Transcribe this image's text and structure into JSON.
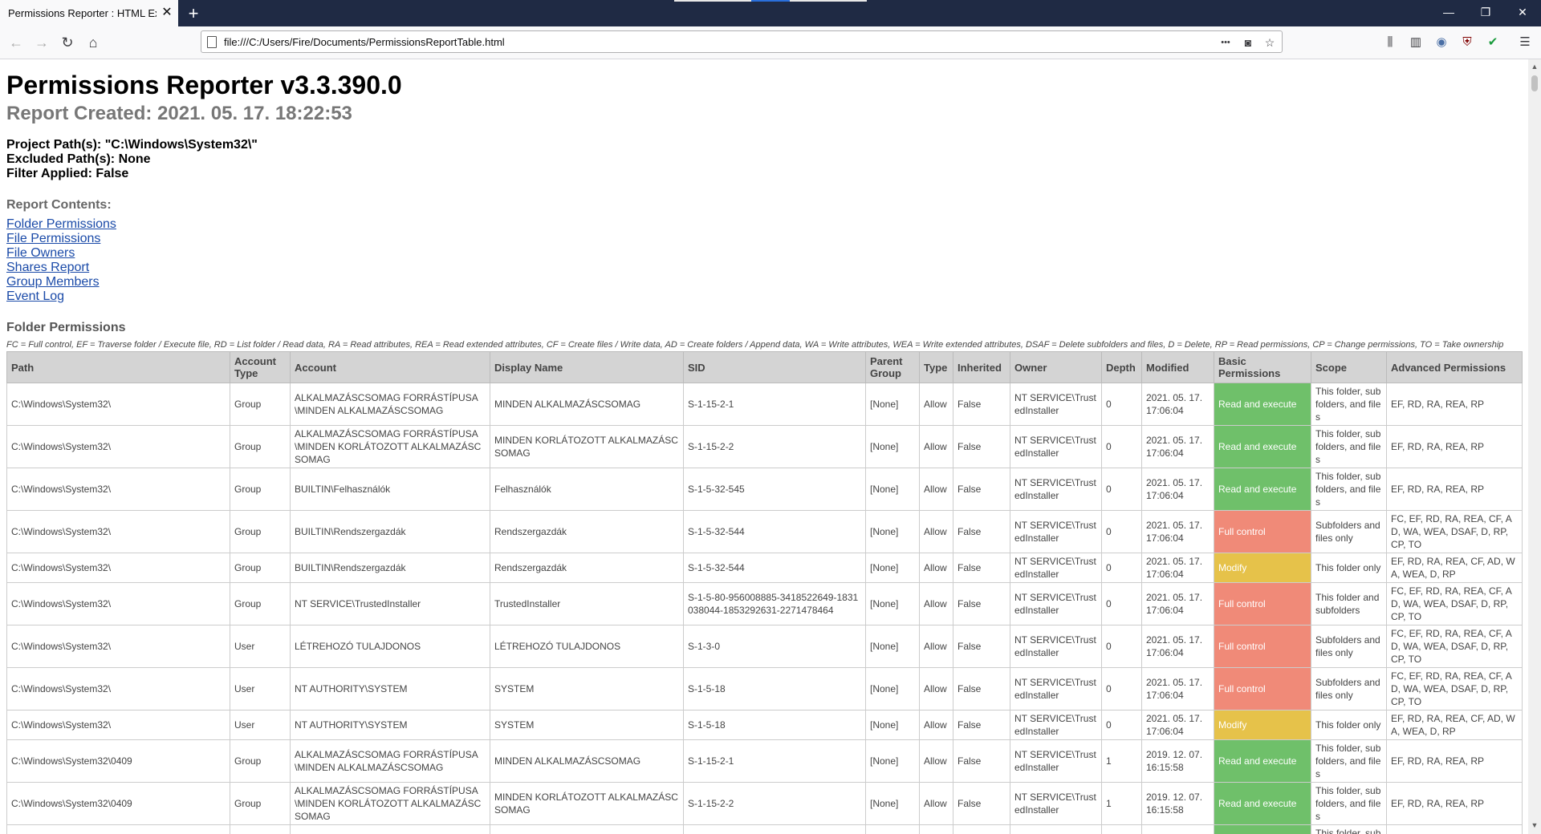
{
  "browser": {
    "tab_title": "Permissions Reporter : HTML Expor",
    "tab_close": "✕",
    "new_tab": "+",
    "url": "file:///C:/Users/Fire/Documents/PermissionsReportTable.html",
    "window_controls": {
      "minimize": "—",
      "restore": "❐",
      "close": "✕"
    },
    "icons": {
      "back": "←",
      "forward": "→",
      "reload": "↻",
      "home": "⌂",
      "more": "•••",
      "pocket": "◙",
      "bookmark": "☆",
      "library": "⫼",
      "sidebar": "▥",
      "account": "◉",
      "ublock": "⛨",
      "shield": "✔",
      "menu": "☰"
    }
  },
  "report": {
    "title": "Permissions Reporter v3.3.390.0",
    "created": "Report Created: 2021. 05. 17. 18:22:53",
    "project_paths": "Project Path(s): \"C:\\Windows\\System32\\\"",
    "excluded_paths": "Excluded Path(s): None",
    "filter": "Filter Applied: False",
    "contents_heading": "Report Contents:",
    "toc": [
      "Folder Permissions",
      "File Permissions",
      "File Owners",
      "Shares Report",
      "Group Members",
      "Event Log"
    ],
    "section_title": "Folder Permissions",
    "legend": "FC = Full control, EF = Traverse folder / Execute file, RD = List folder / Read data, RA = Read attributes, REA = Read extended attributes, CF = Create files / Write data, AD = Create folders / Append data, WA = Write attributes, WEA = Write extended attributes, DSAF = Delete subfolders and files, D = Delete, RP = Read permissions, CP = Change permissions, TO = Take ownership"
  },
  "table": {
    "headers": [
      "Path",
      "Account Type",
      "Account",
      "Display Name",
      "SID",
      "Parent Group",
      "Type",
      "Inherited",
      "Owner",
      "Depth",
      "Modified",
      "Basic Permissions",
      "Scope",
      "Advanced Permissions"
    ],
    "rows": [
      {
        "path": "C:\\Windows\\System32\\",
        "acct_type": "Group",
        "account": "ALKALMAZÁSCSOMAG FORRÁSTÍPUSA\\MINDEN ALKALMAZÁSCSOMAG",
        "display": "MINDEN ALKALMAZÁSCSOMAG",
        "sid": "S-1-15-2-1",
        "parent": "[None]",
        "type": "Allow",
        "inherited": "False",
        "owner": "NT SERVICE\\TrustedInstaller",
        "depth": "0",
        "modified": "2021. 05. 17. 17:06:04",
        "basic": "Read and execute",
        "scope": "This folder, subfolders, and files",
        "advanced": "EF, RD, RA, REA, RP"
      },
      {
        "path": "C:\\Windows\\System32\\",
        "acct_type": "Group",
        "account": "ALKALMAZÁSCSOMAG FORRÁSTÍPUSA\\MINDEN KORLÁTOZOTT ALKALMAZÁSCSOMAG",
        "display": "MINDEN KORLÁTOZOTT ALKALMAZÁSCSOMAG",
        "sid": "S-1-15-2-2",
        "parent": "[None]",
        "type": "Allow",
        "inherited": "False",
        "owner": "NT SERVICE\\TrustedInstaller",
        "depth": "0",
        "modified": "2021. 05. 17. 17:06:04",
        "basic": "Read and execute",
        "scope": "This folder, subfolders, and files",
        "advanced": "EF, RD, RA, REA, RP"
      },
      {
        "path": "C:\\Windows\\System32\\",
        "acct_type": "Group",
        "account": "BUILTIN\\Felhasználók",
        "display": "Felhasználók",
        "sid": "S-1-5-32-545",
        "parent": "[None]",
        "type": "Allow",
        "inherited": "False",
        "owner": "NT SERVICE\\TrustedInstaller",
        "depth": "0",
        "modified": "2021. 05. 17. 17:06:04",
        "basic": "Read and execute",
        "scope": "This folder, subfolders, and files",
        "advanced": "EF, RD, RA, REA, RP"
      },
      {
        "path": "C:\\Windows\\System32\\",
        "acct_type": "Group",
        "account": "BUILTIN\\Rendszergazdák",
        "display": "Rendszergazdák",
        "sid": "S-1-5-32-544",
        "parent": "[None]",
        "type": "Allow",
        "inherited": "False",
        "owner": "NT SERVICE\\TrustedInstaller",
        "depth": "0",
        "modified": "2021. 05. 17. 17:06:04",
        "basic": "Full control",
        "scope": "Subfolders and files only",
        "advanced": "FC, EF, RD, RA, REA, CF, AD, WA, WEA, DSAF, D, RP, CP, TO"
      },
      {
        "path": "C:\\Windows\\System32\\",
        "acct_type": "Group",
        "account": "BUILTIN\\Rendszergazdák",
        "display": "Rendszergazdák",
        "sid": "S-1-5-32-544",
        "parent": "[None]",
        "type": "Allow",
        "inherited": "False",
        "owner": "NT SERVICE\\TrustedInstaller",
        "depth": "0",
        "modified": "2021. 05. 17. 17:06:04",
        "basic": "Modify",
        "scope": "This folder only",
        "advanced": "EF, RD, RA, REA, CF, AD, WA, WEA, D, RP"
      },
      {
        "path": "C:\\Windows\\System32\\",
        "acct_type": "Group",
        "account": "NT SERVICE\\TrustedInstaller",
        "display": "TrustedInstaller",
        "sid": "S-1-5-80-956008885-3418522649-1831038044-1853292631-2271478464",
        "parent": "[None]",
        "type": "Allow",
        "inherited": "False",
        "owner": "NT SERVICE\\TrustedInstaller",
        "depth": "0",
        "modified": "2021. 05. 17. 17:06:04",
        "basic": "Full control",
        "scope": "This folder and subfolders",
        "advanced": "FC, EF, RD, RA, REA, CF, AD, WA, WEA, DSAF, D, RP, CP, TO"
      },
      {
        "path": "C:\\Windows\\System32\\",
        "acct_type": "User",
        "account": "LÉTREHOZÓ TULAJDONOS",
        "display": "LÉTREHOZÓ TULAJDONOS",
        "sid": "S-1-3-0",
        "parent": "[None]",
        "type": "Allow",
        "inherited": "False",
        "owner": "NT SERVICE\\TrustedInstaller",
        "depth": "0",
        "modified": "2021. 05. 17. 17:06:04",
        "basic": "Full control",
        "scope": "Subfolders and files only",
        "advanced": "FC, EF, RD, RA, REA, CF, AD, WA, WEA, DSAF, D, RP, CP, TO"
      },
      {
        "path": "C:\\Windows\\System32\\",
        "acct_type": "User",
        "account": "NT AUTHORITY\\SYSTEM",
        "display": "SYSTEM",
        "sid": "S-1-5-18",
        "parent": "[None]",
        "type": "Allow",
        "inherited": "False",
        "owner": "NT SERVICE\\TrustedInstaller",
        "depth": "0",
        "modified": "2021. 05. 17. 17:06:04",
        "basic": "Full control",
        "scope": "Subfolders and files only",
        "advanced": "FC, EF, RD, RA, REA, CF, AD, WA, WEA, DSAF, D, RP, CP, TO"
      },
      {
        "path": "C:\\Windows\\System32\\",
        "acct_type": "User",
        "account": "NT AUTHORITY\\SYSTEM",
        "display": "SYSTEM",
        "sid": "S-1-5-18",
        "parent": "[None]",
        "type": "Allow",
        "inherited": "False",
        "owner": "NT SERVICE\\TrustedInstaller",
        "depth": "0",
        "modified": "2021. 05. 17. 17:06:04",
        "basic": "Modify",
        "scope": "This folder only",
        "advanced": "EF, RD, RA, REA, CF, AD, WA, WEA, D, RP"
      },
      {
        "path": "C:\\Windows\\System32\\0409",
        "acct_type": "Group",
        "account": "ALKALMAZÁSCSOMAG FORRÁSTÍPUSA\\MINDEN ALKALMAZÁSCSOMAG",
        "display": "MINDEN ALKALMAZÁSCSOMAG",
        "sid": "S-1-15-2-1",
        "parent": "[None]",
        "type": "Allow",
        "inherited": "False",
        "owner": "NT SERVICE\\TrustedInstaller",
        "depth": "1",
        "modified": "2019. 12. 07. 16:15:58",
        "basic": "Read and execute",
        "scope": "This folder, subfolders, and files",
        "advanced": "EF, RD, RA, REA, RP"
      },
      {
        "path": "C:\\Windows\\System32\\0409",
        "acct_type": "Group",
        "account": "ALKALMAZÁSCSOMAG FORRÁSTÍPUSA\\MINDEN KORLÁTOZOTT ALKALMAZÁSCSOMAG",
        "display": "MINDEN KORLÁTOZOTT ALKALMAZÁSCSOMAG",
        "sid": "S-1-15-2-2",
        "parent": "[None]",
        "type": "Allow",
        "inherited": "False",
        "owner": "NT SERVICE\\TrustedInstaller",
        "depth": "1",
        "modified": "2019. 12. 07. 16:15:58",
        "basic": "Read and execute",
        "scope": "This folder, subfolders, and files",
        "advanced": "EF, RD, RA, REA, RP"
      },
      {
        "path": "",
        "acct_type": "",
        "account": "",
        "display": "",
        "sid": "",
        "parent": "",
        "type": "",
        "inherited": "",
        "owner": "",
        "depth": "",
        "modified": "",
        "basic": "",
        "scope": "This folder, subfolders, and files",
        "advanced": ""
      }
    ]
  },
  "colors": {
    "read": "#6fc06a",
    "full": "#f08a78",
    "modify": "#e6c24a",
    "link": "#1a4aa8",
    "titlebar": "#1f2a44"
  }
}
